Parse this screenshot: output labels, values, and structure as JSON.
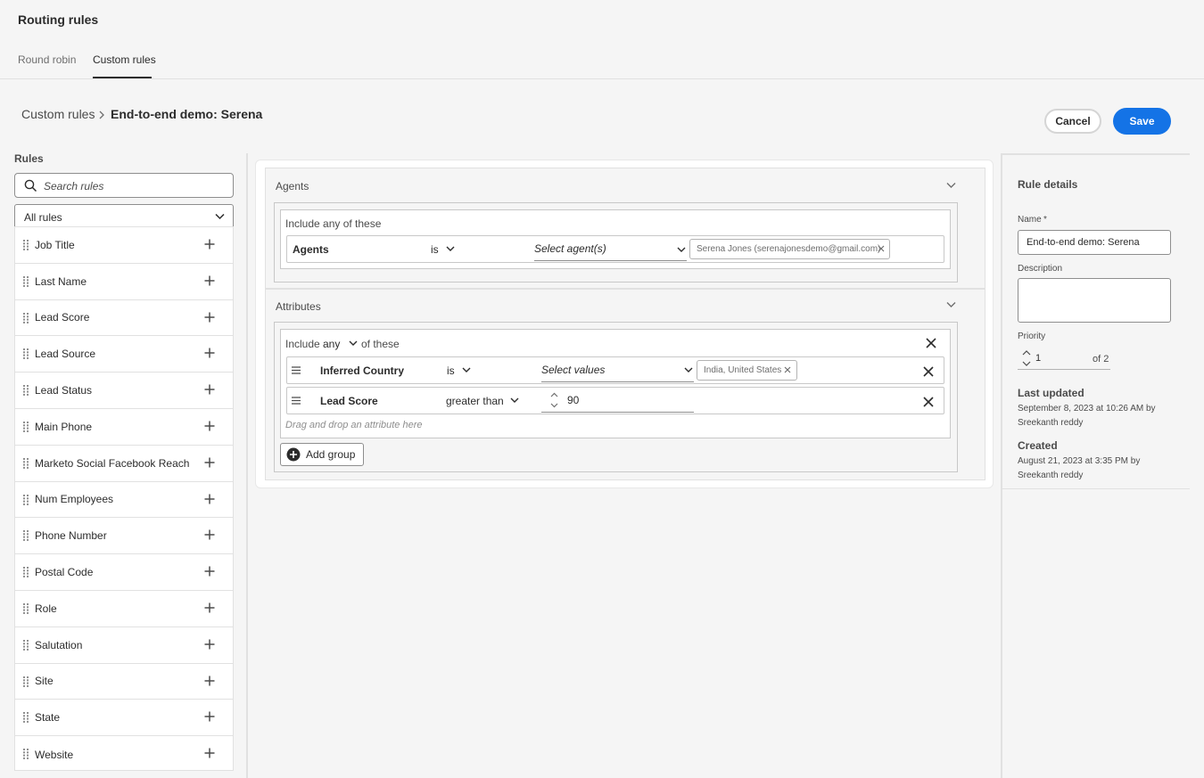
{
  "app": {
    "title": "Routing rules"
  },
  "tabs": [
    {
      "label": "Round robin",
      "active": false
    },
    {
      "label": "Custom rules",
      "active": true
    }
  ],
  "breadcrumb": {
    "parent": "Custom rules",
    "current": "End-to-end demo: Serena"
  },
  "actions": {
    "cancel": "Cancel",
    "save": "Save"
  },
  "colors": {
    "accent": "#1473e6"
  },
  "rules_panel": {
    "heading": "Rules",
    "search_placeholder": "Search rules",
    "filter_value": "All rules",
    "items": [
      "Job Title",
      "Last Name",
      "Lead Score",
      "Lead Source",
      "Lead Status",
      "Main Phone",
      "Marketo Social Facebook Reach",
      "Num Employees",
      "Phone Number",
      "Postal Code",
      "Role",
      "Salutation",
      "Site",
      "State",
      "Website"
    ]
  },
  "agents_section": {
    "title": "Agents",
    "group_label": "Include any of these",
    "condition": {
      "field": "Agents",
      "operator": "is",
      "value_placeholder": "Select agent(s)",
      "tag": "Serena Jones (serenajonesdemo@gmail.com)"
    }
  },
  "attributes_section": {
    "title": "Attributes",
    "include_prefix": "Include",
    "include_mode": "any",
    "include_suffix": "of these",
    "conditions": [
      {
        "field": "Inferred Country",
        "operator": "is",
        "value_placeholder": "Select values",
        "tag": "India, United States"
      },
      {
        "field": "Lead Score",
        "operator": "greater than",
        "value": "90"
      }
    ],
    "drop_hint": "Drag and drop an attribute here",
    "add_group": "Add group"
  },
  "rule_details": {
    "heading": "Rule details",
    "name_label": "Name",
    "required_mark": "*",
    "name_value": "End-to-end demo: Serena",
    "description_label": "Description",
    "description_value": "",
    "priority_label": "Priority",
    "priority_value": "1",
    "priority_total": "of 2",
    "last_updated_label": "Last updated",
    "last_updated_line1": "September 8, 2023 at 10:26 AM by",
    "last_updated_line2": "Sreekanth reddy",
    "created_label": "Created",
    "created_line1": "August 21, 2023 at 3:35 PM by",
    "created_line2": "Sreekanth reddy"
  }
}
